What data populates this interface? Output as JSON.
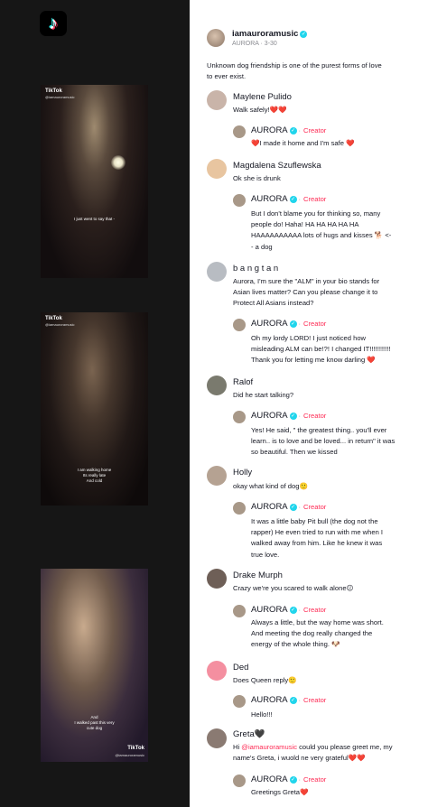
{
  "app": {
    "logo_glyph": "♪"
  },
  "frames": [
    {
      "brand": "TikTok",
      "handle": "@iamauroramusic",
      "caption": "I just went to say that -"
    },
    {
      "brand": "TikTok",
      "handle": "@iamauroramusic",
      "caption": "I am walking home\nIts really late\nAnd cold"
    },
    {
      "brand": "TikTok",
      "handle": "@iamauroramusic",
      "caption": "And\nI walked past this very\ncute dog"
    }
  ],
  "post": {
    "username": "iamauroramusic",
    "author": "AURORA",
    "date": "3-30",
    "caption": "Unknown dog friendship is one of the purest forms of love\nto ever exist."
  },
  "reply_author": {
    "name": "AURORA",
    "badge": "Creator",
    "separator": "·"
  },
  "comments": [
    {
      "name": "Maylene Pulido",
      "text": "Walk safely!❤️❤️",
      "reply": "❤️I made it home and I'm safe ❤️"
    },
    {
      "name": "Magdalena Szuflewska",
      "text": "Ok she is drunk",
      "reply": "But I don't blame you for thinking so, many\npeople do! Haha! HA HA HA HA HA\nHAAAAAAAAAA lots of hugs and kisses 🐕 <-\n- a dog"
    },
    {
      "name": "b a n g t a n",
      "text": "Aurora, I'm sure the \"ALM\" in your bio stands for\nAsian lives matter? Can you please change it to\nProtect All Asians instead?",
      "reply": "Oh my lordy LORD! I just noticed how\nmisleading ALM can be!?! I changed IT!!!!!!!!!!!\nThank you for letting me know darling ❤️"
    },
    {
      "name": "Ralof",
      "text": "Did he start talking?",
      "reply": "Yes! He said, \" the greatest thing.. you'll ever\nlearn.. is to love and be loved... in return\" it was\nso beautiful. Then we kissed"
    },
    {
      "name": "Holly",
      "text": "okay what kind of dog🙂",
      "reply": "It was a little baby Pit bull (the dog not the\nrapper) He even tried to run with me when I\nwalked away from him. Like he knew it was\ntrue love."
    },
    {
      "name": "Drake Murph",
      "text": "Crazy we're you scared to walk alone😐",
      "reply": "Always a little, but the way home was short.\nAnd meeting the dog really changed the\nenergy of the whole thing. 🐶"
    },
    {
      "name": "Ded",
      "text": "Does Queen reply🙂",
      "reply": "Hello!!!"
    },
    {
      "name": "Greta🖤",
      "text_prefix": "Hi ",
      "mention": "@iamauroramusic",
      "text_suffix": " could you please greet me, my\nname's Greta, i wuold ne very grateful❤️❤️",
      "reply": "Greetings Greta❤️"
    }
  ],
  "colors": {
    "accent": "#fe2c55",
    "verified": "#20d5ec",
    "left_bg": "#161616"
  }
}
